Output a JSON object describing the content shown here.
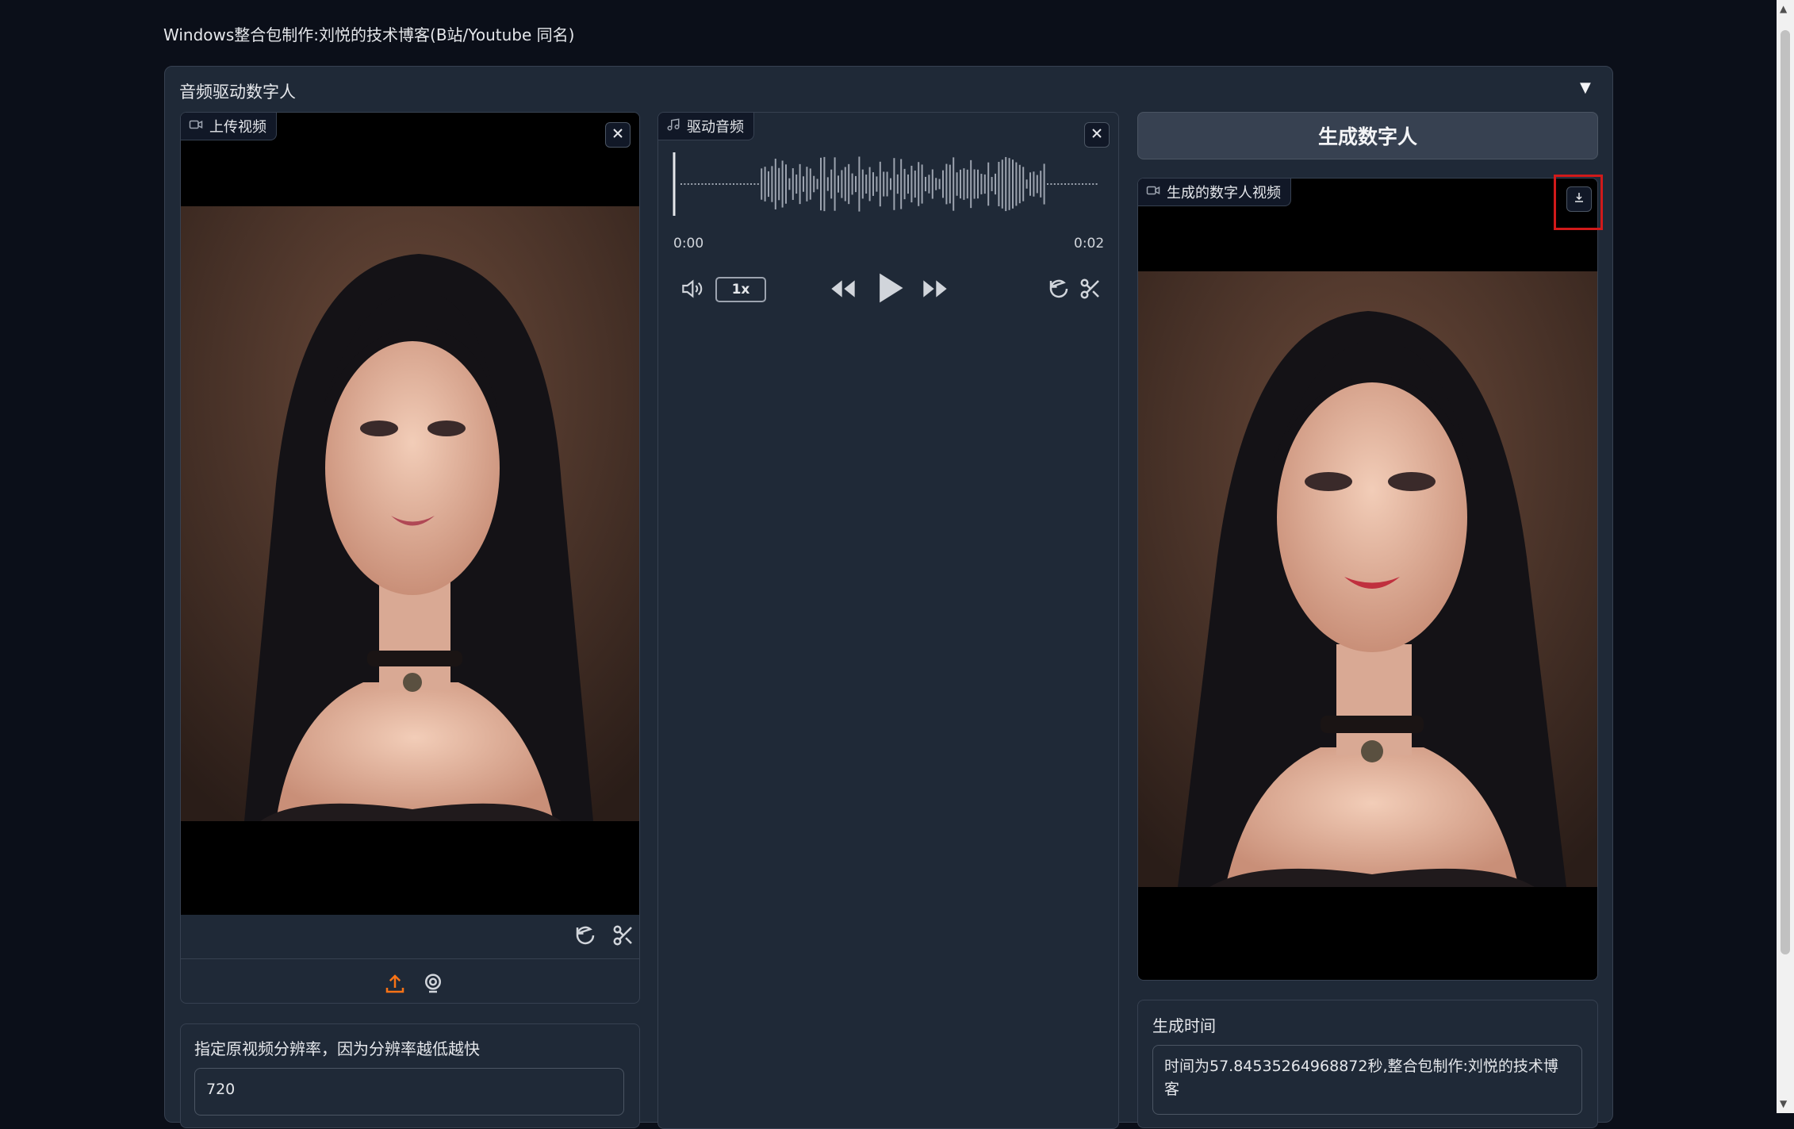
{
  "header": {
    "title": "Windows整合包制作:刘悦的技术博客(B站/Youtube 同名)"
  },
  "accordion": {
    "title": "音频驱动数字人",
    "toggle_icon": "▼"
  },
  "upload_video": {
    "label": "上传视频",
    "icons": [
      "video-icon",
      "close-icon",
      "undo-icon",
      "scissors-icon",
      "upload-icon",
      "webcam-icon"
    ]
  },
  "drive_audio": {
    "label": "驱动音频",
    "time_start": "0:00",
    "time_end": "0:02",
    "speed": "1x",
    "playback_progress": 0,
    "icons": [
      "music-icon",
      "close-icon",
      "volume-icon",
      "rewind-icon",
      "play-icon",
      "fast-forward-icon",
      "undo-icon",
      "scissors-icon"
    ]
  },
  "generate": {
    "button_label": "生成数字人"
  },
  "output_video": {
    "label": "生成的数字人视频",
    "icons": [
      "video-icon",
      "download-icon"
    ]
  },
  "resolution": {
    "label": "指定原视频分辨率，因为分辨率越低越快",
    "value": "720"
  },
  "gen_time": {
    "label": "生成时间",
    "value": "时间为57.84535264968872秒,整合包制作:刘悦的技术博客"
  },
  "colors": {
    "page_bg": "#0b0f19",
    "panel_bg": "#1f2937",
    "border": "#374151",
    "accent": "#f97316",
    "highlight": "#d11a1a"
  }
}
